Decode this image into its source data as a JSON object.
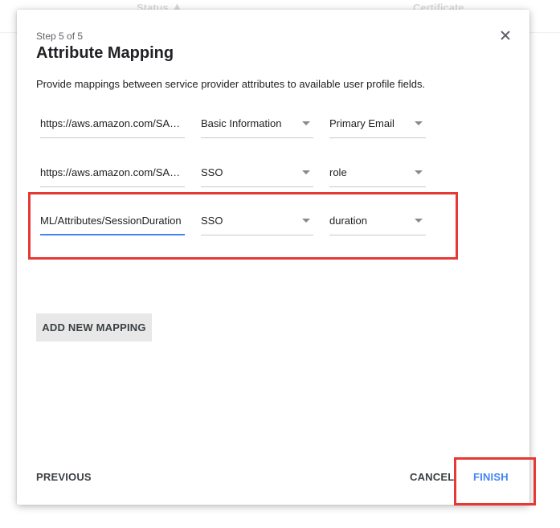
{
  "background": {
    "columns": [
      "Status",
      "Certificate"
    ]
  },
  "dialog": {
    "step": "Step 5 of 5",
    "title": "Attribute Mapping",
    "description": "Provide mappings between service provider attributes to available user profile fields.",
    "rows": [
      {
        "attribute": "https://aws.amazon.com/SA…",
        "category": "Basic Information",
        "field": "Primary Email"
      },
      {
        "attribute": "https://aws.amazon.com/SA…",
        "category": "SSO",
        "field": "role"
      },
      {
        "attribute": "ML/Attributes/SessionDuration",
        "category": "SSO",
        "field": "duration"
      }
    ],
    "add_mapping_label": "ADD NEW MAPPING",
    "previous_label": "PREVIOUS",
    "cancel_label": "CANCEL",
    "finish_label": "FINISH"
  },
  "colors": {
    "accent": "#4285f4",
    "highlight": "#e53935"
  }
}
